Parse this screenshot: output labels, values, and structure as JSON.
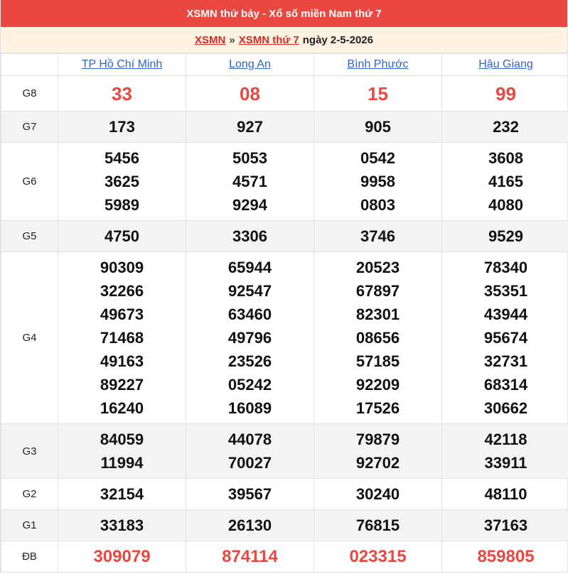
{
  "header": {
    "title": "XSMN thứ bảy - Xổ số miền Nam thứ 7",
    "crumb_link1": "XSMN",
    "crumb_sep": "»",
    "crumb_link2": "XSMN thứ 7",
    "crumb_date": "ngày 2-5-2026"
  },
  "colors": {
    "accent": "#e9473f",
    "link": "#2f63c8",
    "crumb_bg": "#fff2e1"
  },
  "provinces": [
    "TP Hồ Chí Minh",
    "Long An",
    "Bình Phước",
    "Hậu Giang"
  ],
  "rows": [
    {
      "label": "G8",
      "style": "big-red",
      "alt": false,
      "values": [
        [
          "33"
        ],
        [
          "08"
        ],
        [
          "15"
        ],
        [
          "99"
        ]
      ]
    },
    {
      "label": "G7",
      "style": "num",
      "alt": true,
      "values": [
        [
          "173"
        ],
        [
          "927"
        ],
        [
          "905"
        ],
        [
          "232"
        ]
      ]
    },
    {
      "label": "G6",
      "style": "num",
      "alt": false,
      "values": [
        [
          "5456",
          "3625",
          "5989"
        ],
        [
          "5053",
          "4571",
          "9294"
        ],
        [
          "0542",
          "9958",
          "0803"
        ],
        [
          "3608",
          "4165",
          "4080"
        ]
      ]
    },
    {
      "label": "G5",
      "style": "num",
      "alt": true,
      "values": [
        [
          "4750"
        ],
        [
          "3306"
        ],
        [
          "3746"
        ],
        [
          "9529"
        ]
      ]
    },
    {
      "label": "G4",
      "style": "num",
      "alt": false,
      "values": [
        [
          "90309",
          "32266",
          "49673",
          "71468",
          "49163",
          "89227",
          "16240"
        ],
        [
          "65944",
          "92547",
          "63460",
          "49796",
          "23526",
          "05242",
          "16089"
        ],
        [
          "20523",
          "67897",
          "82301",
          "08656",
          "57185",
          "92209",
          "17526"
        ],
        [
          "78340",
          "35351",
          "43944",
          "95674",
          "32731",
          "68314",
          "30662"
        ]
      ]
    },
    {
      "label": "G3",
      "style": "num",
      "alt": true,
      "values": [
        [
          "84059",
          "11994"
        ],
        [
          "44078",
          "70027"
        ],
        [
          "79879",
          "92702"
        ],
        [
          "42118",
          "33911"
        ]
      ]
    },
    {
      "label": "G2",
      "style": "num",
      "alt": false,
      "values": [
        [
          "32154"
        ],
        [
          "39567"
        ],
        [
          "30240"
        ],
        [
          "48110"
        ]
      ]
    },
    {
      "label": "G1",
      "style": "num",
      "alt": true,
      "values": [
        [
          "33183"
        ],
        [
          "26130"
        ],
        [
          "76815"
        ],
        [
          "37163"
        ]
      ]
    },
    {
      "label": "ĐB",
      "style": "db-red",
      "alt": false,
      "values": [
        [
          "309079"
        ],
        [
          "874114"
        ],
        [
          "023315"
        ],
        [
          "859805"
        ]
      ]
    }
  ]
}
